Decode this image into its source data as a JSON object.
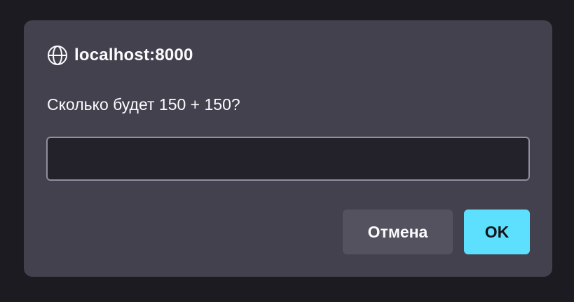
{
  "dialog": {
    "origin": "localhost:8000",
    "message": "Сколько будет 150 + 150?",
    "input_value": "",
    "cancel_label": "Отмена",
    "ok_label": "OK",
    "icon": "globe-icon"
  },
  "colors": {
    "backdrop": "#1c1b22",
    "dialog_bg": "#42414d",
    "input_bg": "#23222b",
    "input_border": "#8f8f9d",
    "cancel_bg": "#53525e",
    "ok_bg": "#5de0fd",
    "text": "#fbfbfe"
  }
}
